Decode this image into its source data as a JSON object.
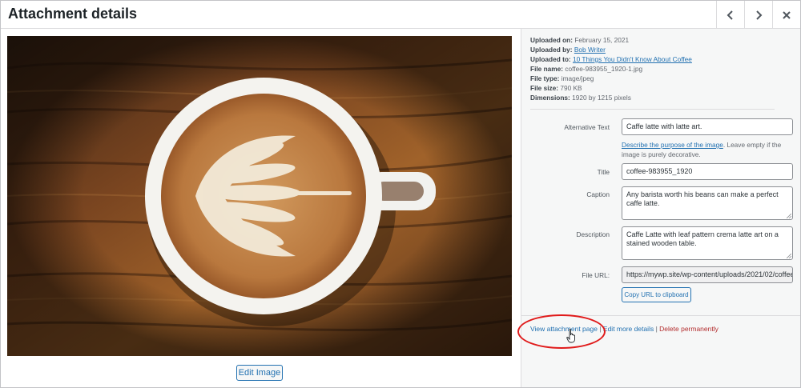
{
  "modal": {
    "title": "Attachment details",
    "prev_icon": "chevron-left-icon",
    "next_icon": "chevron-right-icon",
    "close_icon": "close-icon"
  },
  "image": {
    "description": "coffee-983955_1920-1.jpg",
    "edit_label": "Edit Image"
  },
  "meta": {
    "uploaded_on_label": "Uploaded on:",
    "uploaded_on": "February 15, 2021",
    "uploaded_by_label": "Uploaded by:",
    "uploaded_by": "Bob Writer",
    "uploaded_to_label": "Uploaded to:",
    "uploaded_to": "10 Things You Didn't Know About Coffee",
    "file_name_label": "File name:",
    "file_name": "coffee-983955_1920-1.jpg",
    "file_type_label": "File type:",
    "file_type": "image/jpeg",
    "file_size_label": "File size:",
    "file_size": "790 KB",
    "dimensions_label": "Dimensions:",
    "dimensions": "1920 by 1215 pixels"
  },
  "form": {
    "alt_label": "Alternative Text",
    "alt_value": "Caffe latte with latte art.",
    "help_link": "Describe the purpose of the image",
    "help_text": ". Leave empty if the image is purely decorative.",
    "title_label": "Title",
    "title_value": "coffee-983955_1920",
    "caption_label": "Caption",
    "caption_value": "Any barista worth his beans can make a perfect caffe latte.",
    "description_label": "Description",
    "description_value": "Caffe Latte with leaf pattern crema latte art on a stained wooden table.",
    "url_label": "File URL:",
    "url_value": "https://mywp.site/wp-content/uploads/2021/02/coffee-983955_1920-1.jpg",
    "copy_label": "Copy URL to clipboard"
  },
  "actions": {
    "view": "View attachment page",
    "sep1": " | ",
    "edit": "Edit more details",
    "sep2": " | ",
    "delete": "Delete permanently"
  },
  "colors": {
    "link": "#2271b1",
    "delete": "#b32d2e",
    "highlight": "#e01b1b",
    "sidebar_bg": "#f6f7f7"
  }
}
